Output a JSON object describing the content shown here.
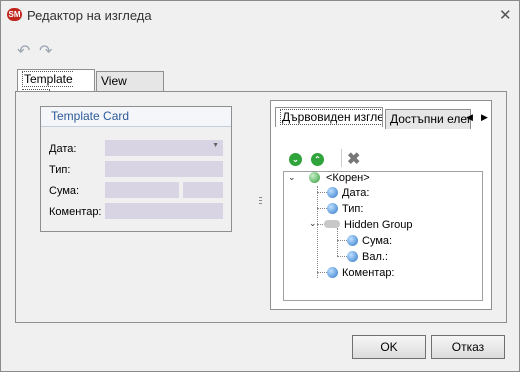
{
  "window": {
    "title": "Редактор на изгледа",
    "app_icon": "SM",
    "close_glyph": "✕"
  },
  "toolbar": {
    "undo_icon": "undo-icon",
    "redo_icon": "redo-icon"
  },
  "tabs": [
    {
      "label": "Template Card"
    },
    {
      "label": "View Layout"
    }
  ],
  "card": {
    "title": "Template Card",
    "fields": [
      {
        "label": "Дата:"
      },
      {
        "label": "Тип:"
      },
      {
        "label": "Сума:"
      },
      {
        "label": "Коментар:"
      }
    ]
  },
  "right": {
    "tabs": [
      {
        "label": "Дървовиден изглед"
      },
      {
        "label": "Достъпни елементи"
      }
    ],
    "tree": {
      "root": "<Корен>",
      "items": [
        "Дата:",
        "Тип:",
        "Hidden Group",
        "Сума:",
        "Вал.:",
        "Коментар:"
      ]
    }
  },
  "buttons": {
    "ok": "OK",
    "cancel": "Отказ"
  }
}
